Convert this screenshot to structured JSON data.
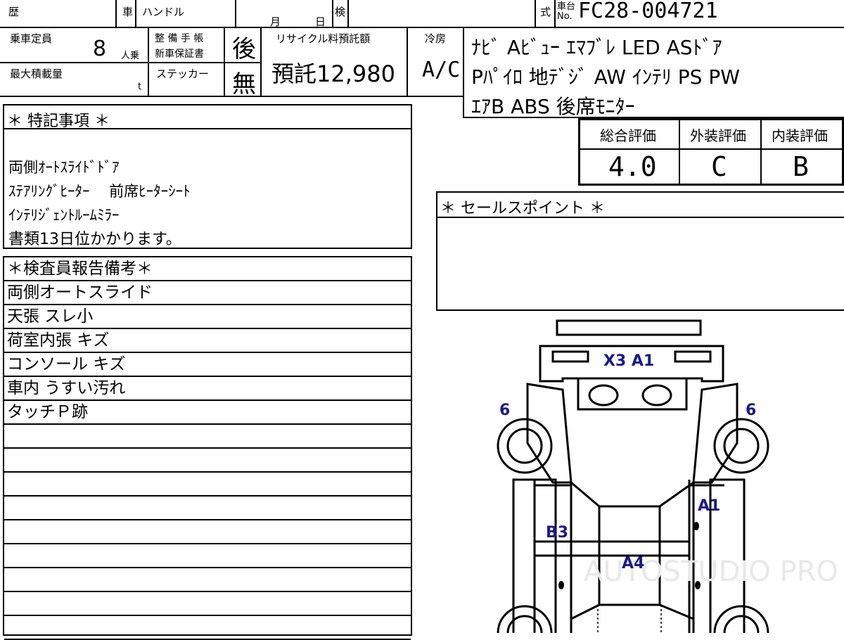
{
  "header": {
    "reki_label": "歴",
    "sha_label": "車",
    "handle_label": "ハンドル",
    "month_label": "月",
    "day_label": "日",
    "ken_label": "検",
    "shiki_label": "式",
    "chassis_label_top": "車台",
    "chassis_label_bottom": "No.",
    "chassis_no": "FC28-004721"
  },
  "specs": {
    "capacity_label": "乗車定員",
    "capacity_value": "8",
    "capacity_unit": "人乗",
    "maintenance_label_1": "整 備 手 帳",
    "maintenance_label_2": "新車保証書",
    "maintenance_value": "後",
    "max_load_label": "最大積載量",
    "max_load_unit": "t",
    "sticker_label": "ステッカー",
    "sticker_value": "無",
    "recycle_label": "リサイクル料預託額",
    "recycle_value": "預託12,980",
    "aircon_label": "冷房",
    "aircon_value": "A/C"
  },
  "equipment": {
    "line1": "ﾅﾋﾞ Aﾋﾞｭｰ ｴﾏﾌﾞﾚ LED ASﾄﾞｱ",
    "line2": "Pﾊﾟｲﾛ 地ﾃﾞｼﾞ AW ｲﾝﾃﾘ PS PW",
    "line3": "ｴｱB ABS 後席ﾓﾆﾀｰ"
  },
  "scores": {
    "total_label": "総合評価",
    "total_value": "4.0",
    "exterior_label": "外装評価",
    "exterior_value": "C",
    "interior_label": "内装評価",
    "interior_value": "B"
  },
  "special_notes": {
    "title": "＊ 特記事項 ＊",
    "lines": [
      "両側ｵｰﾄｽﾗｲﾄﾞﾄﾞｱ",
      "ｽﾃｱﾘﾝｸﾞﾋｰﾀｰ　 前席ﾋｰﾀｰｼｰﾄ",
      "ｲﾝﾃﾘｼﾞｪﾝﾄﾙｰﾑﾐﾗｰ",
      "書類13日位かかります。"
    ]
  },
  "sales_point": {
    "title": "＊ セールスポイント ＊"
  },
  "inspector": {
    "title": "＊検査員報告備考＊",
    "rows": [
      "両側オートスライド",
      "天張 スレ小",
      "荷室内張 キズ",
      "コンソール キズ",
      "車内 うすい汚れ",
      "タッチＰ跡",
      "",
      "",
      "",
      "",
      "",
      "",
      "",
      "",
      ""
    ]
  },
  "damage_marks": {
    "front_glass": "X3 A1",
    "left_tire": "6",
    "right_tire": "6",
    "right_front_panel": "A1",
    "left_middle": "B3",
    "roof": "A4"
  },
  "watermark": "AUTOSTUDIO PRO"
}
